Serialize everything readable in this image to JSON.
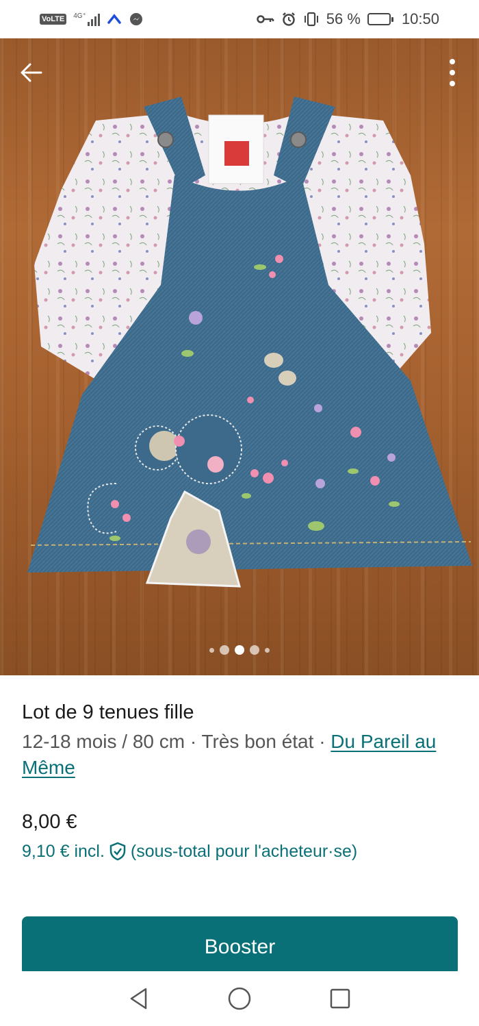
{
  "status_bar": {
    "volte": "VoLTE",
    "network": "4G⁺",
    "battery_percent": "56 %",
    "battery_level": 0.56,
    "time": "10:50"
  },
  "photo": {
    "carousel_count": 5,
    "carousel_active": 2
  },
  "product": {
    "title": "Lot de 9 tenues fille",
    "meta_prefix": "12-18 mois / 80 cm · Très bon état · ",
    "brand": "Du Pareil au Même",
    "price": "8,00 €",
    "price_incl_amount": "9,10 € incl.",
    "price_incl_note": "(sous-total pour l'acheteur·se)"
  },
  "actions": {
    "booster_label": "Booster"
  },
  "colors": {
    "accent": "#0a7077"
  },
  "icons": {
    "back": "arrow-left-icon",
    "more": "more-vertical-icon",
    "shield": "shield-check-icon",
    "nav_back": "triangle-back-icon",
    "nav_home": "circle-home-icon",
    "nav_recent": "square-recent-icon"
  }
}
